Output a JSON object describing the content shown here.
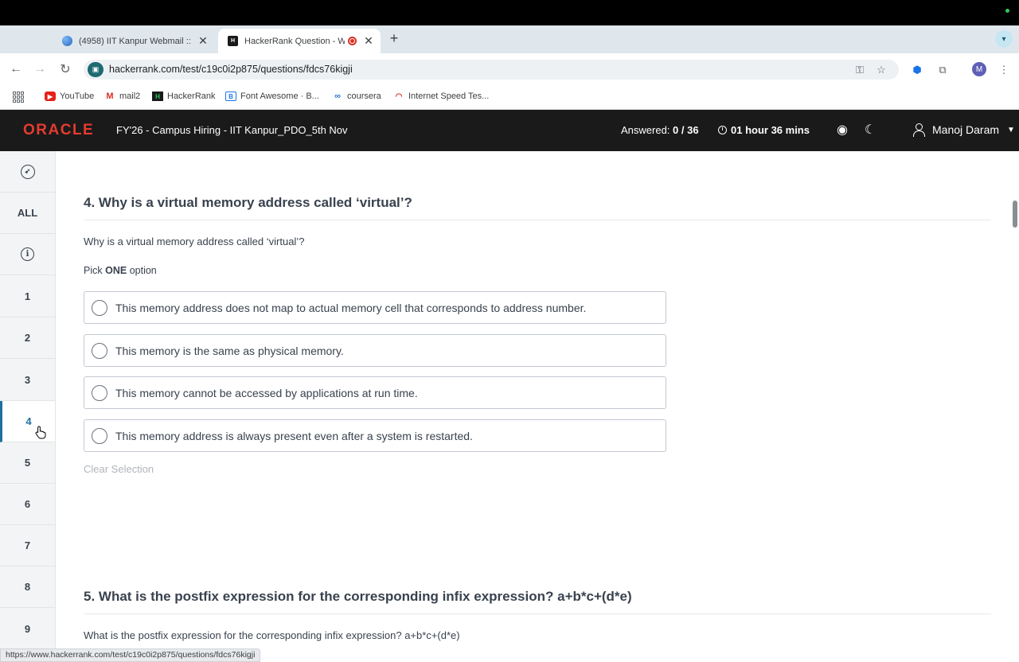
{
  "browser": {
    "tabs": [
      {
        "title": "(4958) IIT Kanpur Webmail ::",
        "active": false
      },
      {
        "title": "HackerRank Question - W",
        "active": true
      }
    ],
    "url": "hackerrank.com/test/c19c0i2p875/questions/fdcs76kigji",
    "profile_initial": "M",
    "bookmarks": [
      {
        "label": "YouTube",
        "icon": "youtube-icon"
      },
      {
        "label": "mail2",
        "icon": "gmail-icon"
      },
      {
        "label": "HackerRank",
        "icon": "hackerrank-icon"
      },
      {
        "label": "Font Awesome · B...",
        "icon": "bootstrap-icon"
      },
      {
        "label": "coursera",
        "icon": "coursera-icon"
      },
      {
        "label": "Internet Speed Tes...",
        "icon": "speedometer-icon"
      }
    ],
    "status_url": "https://www.hackerrank.com/test/c19c0i2p875/questions/fdcs76kigji"
  },
  "header": {
    "logo": "ORACLE",
    "test_title": "FY'26 - Campus Hiring - IIT Kanpur_PDO_5th Nov",
    "answered_label": "Answered:",
    "answered_value": "0 / 36",
    "time_left": "01 hour 36 mins",
    "user_name": "Manoj Daram"
  },
  "sidebar": {
    "all_label": "ALL",
    "questions": [
      "1",
      "2",
      "3",
      "4",
      "5",
      "6",
      "7",
      "8",
      "9"
    ],
    "active_question": "4"
  },
  "questions": [
    {
      "title": "4. Why is a virtual memory address called ‘virtual’?",
      "text": "Why is a virtual memory address called ‘virtual’?",
      "pick_prefix": "Pick",
      "pick_bold": "ONE",
      "pick_suffix": "option",
      "options": [
        "This memory address does not map to actual memory cell that corresponds to address number.",
        "This memory is the same as physical memory.",
        "This memory cannot be accessed by applications at run time.",
        "This memory address is always present even after a system is restarted."
      ],
      "clear_label": "Clear Selection"
    },
    {
      "title": "5. What is the postfix expression for the corresponding infix expression? a+b*c+(d*e)",
      "text": "What is the postfix expression for the corresponding infix expression? a+b*c+(d*e)"
    }
  ],
  "colors": {
    "header_bg": "#1a1a1a",
    "oracle_red": "#e63b2e",
    "active_blue": "#1f6f9e",
    "text": "#39424e"
  }
}
